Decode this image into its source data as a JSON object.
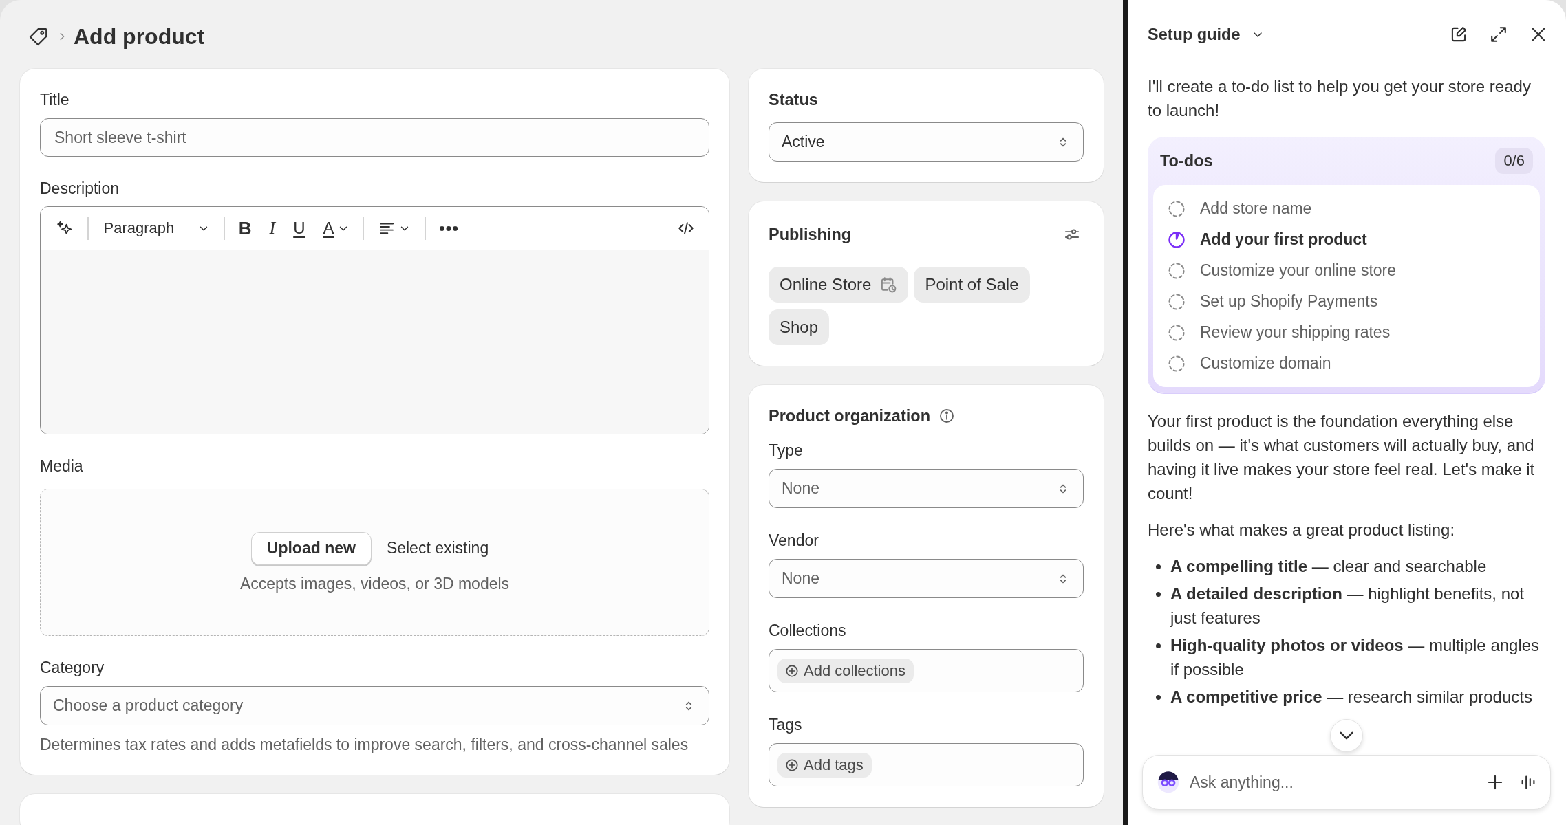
{
  "page": {
    "title": "Add product"
  },
  "product_card": {
    "title_field": {
      "label": "Title",
      "placeholder": "Short sleeve t-shirt"
    },
    "description": {
      "label": "Description",
      "toolbar": [
        [
          {
            "kind": "magic"
          }
        ],
        [
          {
            "kind": "block_style",
            "label": "Paragraph"
          }
        ],
        [
          {
            "kind": "bold",
            "label": "B"
          },
          {
            "kind": "italic",
            "label": "I"
          },
          {
            "kind": "underline",
            "label": "U"
          },
          {
            "kind": "text_color",
            "label": "A"
          }
        ],
        [
          {
            "kind": "align"
          }
        ],
        [
          {
            "kind": "more"
          }
        ],
        [
          {
            "kind": "code"
          }
        ]
      ]
    },
    "media": {
      "label": "Media",
      "upload_button": "Upload new",
      "select_link": "Select existing",
      "hint": "Accepts images, videos, or 3D models"
    },
    "category": {
      "label": "Category",
      "placeholder": "Choose a product category",
      "help": "Determines tax rates and adds metafields to improve search, filters, and cross-channel sales"
    }
  },
  "status_card": {
    "label": "Status",
    "value": "Active"
  },
  "publishing_card": {
    "title": "Publishing",
    "channels": [
      {
        "name": "Online Store",
        "scheduled": true
      },
      {
        "name": "Point of Sale",
        "scheduled": false
      },
      {
        "name": "Shop",
        "scheduled": false
      }
    ]
  },
  "organization_card": {
    "title": "Product organization",
    "fields": [
      {
        "kind": "select",
        "label": "Type",
        "placeholder": "None"
      },
      {
        "kind": "select",
        "label": "Vendor",
        "placeholder": "None"
      },
      {
        "kind": "tag_input",
        "label": "Collections",
        "action": "Add collections"
      },
      {
        "kind": "tag_input",
        "label": "Tags",
        "action": "Add tags"
      }
    ]
  },
  "setup_guide": {
    "title": "Setup guide",
    "intro": "I'll create a to-do list to help you get your store ready to launch!",
    "todos": {
      "title": "To-dos",
      "count": "0/6",
      "items": [
        {
          "label": "Add store name",
          "current": false
        },
        {
          "label": "Add your first product",
          "current": true
        },
        {
          "label": "Customize your online store",
          "current": false
        },
        {
          "label": "Set up Shopify Payments",
          "current": false
        },
        {
          "label": "Review your shipping rates",
          "current": false
        },
        {
          "label": "Customize domain",
          "current": false
        }
      ]
    },
    "message": "Your first product is the foundation everything else builds on — it's what customers will actually buy, and having it live makes your store feel real. Let's make it count!",
    "list_intro": "Here's what makes a great product listing:",
    "tips": [
      "**A compelling title** — clear and searchable",
      "**A detailed description** — highlight benefits, not just features",
      "**High-quality photos or videos** — multiple angles if possible",
      "**A competitive price** — research similar products"
    ],
    "chat": {
      "placeholder": "Ask anything..."
    }
  }
}
